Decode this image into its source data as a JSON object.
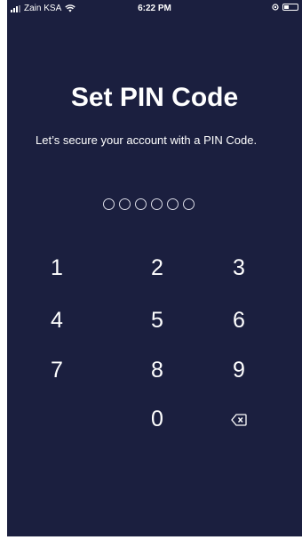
{
  "status_bar": {
    "carrier": "Zain KSA",
    "time": "6:22 PM"
  },
  "title": "Set PIN Code",
  "subtitle": "Let’s secure your account with a PIN Code.",
  "pin": {
    "length": 6,
    "filled": 0
  },
  "keypad": {
    "keys": [
      "1",
      "2",
      "3",
      "4",
      "5",
      "6",
      "7",
      "8",
      "9",
      "0"
    ],
    "backspace_icon": "backspace-icon"
  },
  "colors": {
    "background": "#1b1f3f",
    "text": "#ffffff"
  }
}
